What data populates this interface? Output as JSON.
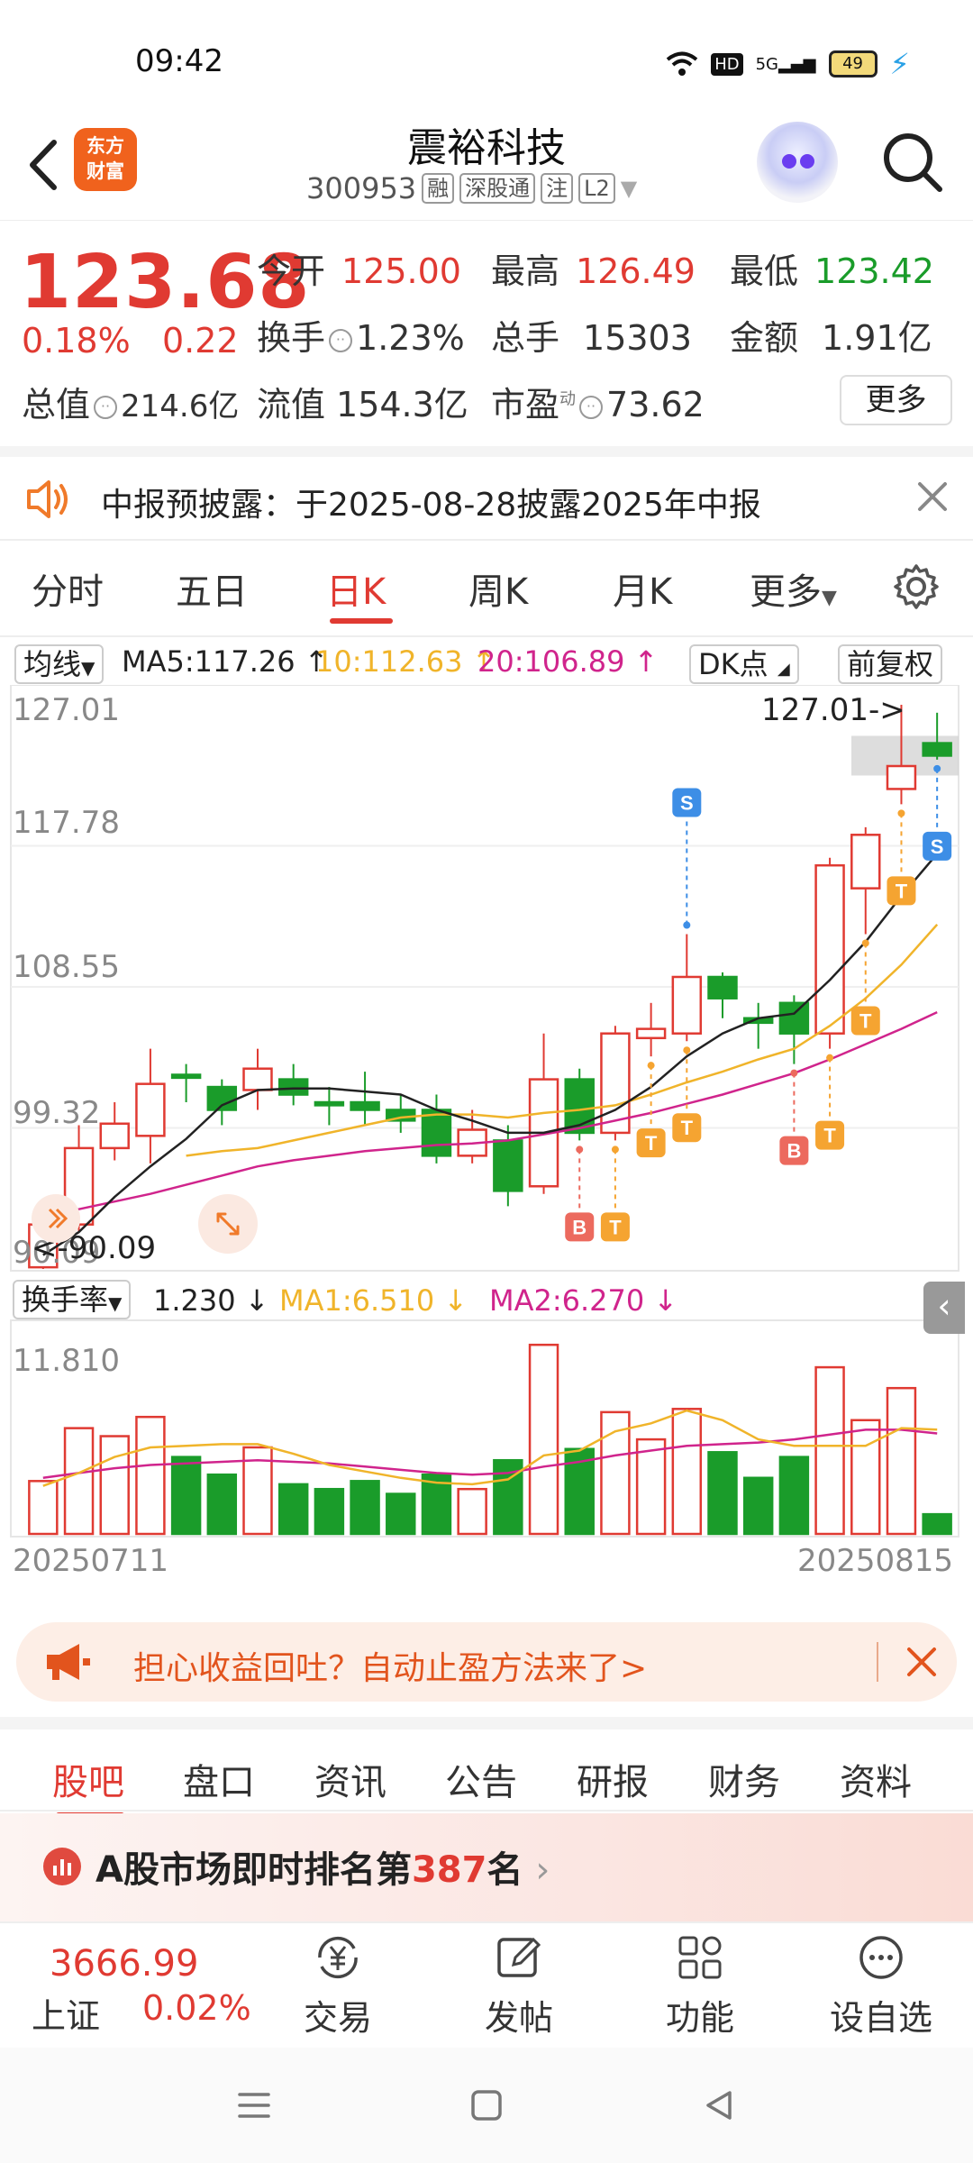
{
  "status_bar": {
    "time": "09:42",
    "hd": "HD",
    "network": "5G",
    "battery": "49"
  },
  "header": {
    "stock_name": "震裕科技",
    "stock_code": "300953",
    "tags": [
      "融",
      "深股通",
      "注",
      "L2"
    ],
    "logo_text": [
      "东方",
      "财富"
    ]
  },
  "quote": {
    "price": "123.68",
    "change_pct": "0.18%",
    "change": "0.22",
    "open_label": "今开",
    "open": "125.00",
    "high_label": "最高",
    "high": "126.49",
    "low_label": "最低",
    "low": "123.42",
    "turnover_label": "换手",
    "turnover": "1.23%",
    "volume_label": "总手",
    "volume": "15303",
    "amount_label": "金额",
    "amount": "1.91亿",
    "mktcap_label": "总值",
    "mktcap": "214.6亿",
    "float_label": "流值",
    "float": "154.3亿",
    "pe_label": "市盈",
    "pe_sup": "动",
    "pe": "73.62",
    "more": "更多"
  },
  "notice": {
    "text": "中报预披露：于2025-08-28披露2025年中报"
  },
  "chart_tabs": [
    "分时",
    "五日",
    "日K",
    "周K",
    "月K",
    "更多"
  ],
  "chart_tab_active": 2,
  "ma_legend": {
    "select": "均线",
    "ma5": "MA5:117.26",
    "ma10": "10:112.63",
    "ma20": "20:106.89",
    "dk": "DK点",
    "adjust": "前复权"
  },
  "colors": {
    "up": "#e03a32",
    "down": "#1a9c2a",
    "ma5": "#222222",
    "ma10": "#f0b42a",
    "ma20": "#d0248c",
    "brand": "#f0621d"
  },
  "chart_data": [
    {
      "type": "candlestick",
      "y_ticks": [
        "127.01",
        "117.78",
        "108.55",
        "99.32",
        "90.09"
      ],
      "ylim": [
        90.09,
        127.01
      ],
      "max_label": "127.01->",
      "min_label": "<-90.09",
      "x_start": "20250711",
      "x_end": "20250815",
      "candles": [
        {
          "o": 90.2,
          "c": 93.0,
          "h": 94.5,
          "l": 90.09
        },
        {
          "o": 93.0,
          "c": 98.0,
          "h": 99.5,
          "l": 92.5
        },
        {
          "o": 98.0,
          "c": 99.6,
          "h": 101.0,
          "l": 97.2
        },
        {
          "o": 98.8,
          "c": 102.2,
          "h": 104.5,
          "l": 97.0
        },
        {
          "o": 102.8,
          "c": 102.6,
          "h": 103.5,
          "l": 101.0
        },
        {
          "o": 102.0,
          "c": 100.5,
          "h": 102.5,
          "l": 99.5
        },
        {
          "o": 101.8,
          "c": 103.2,
          "h": 104.5,
          "l": 100.5
        },
        {
          "o": 102.5,
          "c": 101.5,
          "h": 103.5,
          "l": 100.8
        },
        {
          "o": 101.0,
          "c": 100.8,
          "h": 102.0,
          "l": 99.5
        },
        {
          "o": 101.0,
          "c": 100.5,
          "h": 103.0,
          "l": 99.5
        },
        {
          "o": 100.5,
          "c": 99.8,
          "h": 101.5,
          "l": 99.0
        },
        {
          "o": 100.5,
          "c": 97.5,
          "h": 101.5,
          "l": 97.0
        },
        {
          "o": 97.5,
          "c": 99.2,
          "h": 100.5,
          "l": 97.0
        },
        {
          "o": 98.5,
          "c": 95.2,
          "h": 99.5,
          "l": 94.2
        },
        {
          "o": 95.5,
          "c": 102.5,
          "h": 105.5,
          "l": 95.0
        },
        {
          "o": 102.5,
          "c": 99.0,
          "h": 103.2,
          "l": 98.5
        },
        {
          "o": 99.0,
          "c": 105.5,
          "h": 106.0,
          "l": 98.5
        },
        {
          "o": 105.2,
          "c": 105.8,
          "h": 107.5,
          "l": 104.0
        },
        {
          "o": 105.5,
          "c": 109.2,
          "h": 112.0,
          "l": 105.0
        },
        {
          "o": 109.2,
          "c": 107.8,
          "h": 109.5,
          "l": 106.5
        },
        {
          "o": 106.5,
          "c": 106.2,
          "h": 107.5,
          "l": 104.5
        },
        {
          "o": 107.5,
          "c": 105.5,
          "h": 108.0,
          "l": 103.5
        },
        {
          "o": 105.5,
          "c": 116.5,
          "h": 117.0,
          "l": 104.5
        },
        {
          "o": 115.0,
          "c": 118.5,
          "h": 119.0,
          "l": 112.0
        },
        {
          "o": 121.5,
          "c": 123.0,
          "h": 127.01,
          "l": 120.5
        },
        {
          "o": 124.5,
          "c": 123.68,
          "h": 126.49,
          "l": 123.42
        }
      ],
      "ma5": [
        91.0,
        92.5,
        94.8,
        96.8,
        98.6,
        100.8,
        101.8,
        101.9,
        101.9,
        101.7,
        101.5,
        100.5,
        99.8,
        99.0,
        99.0,
        99.5,
        100.5,
        102.0,
        104.0,
        105.5,
        106.5,
        106.8,
        109.0,
        111.5,
        114.5,
        117.26
      ],
      "ma10": [
        null,
        null,
        null,
        null,
        97.5,
        97.8,
        98.0,
        98.5,
        99.0,
        99.5,
        100.0,
        100.2,
        100.2,
        100.0,
        100.3,
        100.5,
        100.8,
        101.5,
        102.3,
        103.0,
        103.8,
        104.5,
        106.0,
        107.8,
        110.0,
        112.63
      ],
      "ma20": [
        93.5,
        94.0,
        94.5,
        95.0,
        95.6,
        96.2,
        96.8,
        97.2,
        97.5,
        97.8,
        98.0,
        98.2,
        98.3,
        98.5,
        98.9,
        99.3,
        99.8,
        100.3,
        100.9,
        101.5,
        102.2,
        102.9,
        103.8,
        104.8,
        105.8,
        106.89
      ],
      "markers": [
        {
          "i": 15,
          "label": "B",
          "side": "below"
        },
        {
          "i": 16,
          "label": "T",
          "side": "below"
        },
        {
          "i": 17,
          "label": "T",
          "side": "below"
        },
        {
          "i": 18,
          "label": "T",
          "side": "below"
        },
        {
          "i": 18,
          "label": "S",
          "side": "above"
        },
        {
          "i": 21,
          "label": "B",
          "side": "below"
        },
        {
          "i": 22,
          "label": "T",
          "side": "below"
        },
        {
          "i": 23,
          "label": "T",
          "side": "below"
        },
        {
          "i": 24,
          "label": "T",
          "side": "below"
        },
        {
          "i": 25,
          "label": "S",
          "side": "below"
        }
      ]
    },
    {
      "type": "bar",
      "name": "换手率",
      "current": "1.230",
      "ma1_label": "MA1:6.510",
      "ma2_label": "MA2:6.270",
      "y_max_label": "11.810",
      "ylim": [
        0,
        11.81
      ],
      "values": [
        3.3,
        6.6,
        6.1,
        7.3,
        4.8,
        3.7,
        5.4,
        3.1,
        2.8,
        3.3,
        2.5,
        3.7,
        2.8,
        4.6,
        11.8,
        5.3,
        7.6,
        5.9,
        7.8,
        5.1,
        3.5,
        4.8,
        10.4,
        7.1,
        9.1,
        1.23
      ],
      "ma1": [
        3.0,
        3.8,
        4.8,
        5.4,
        5.5,
        5.6,
        5.6,
        5.0,
        4.3,
        3.9,
        3.5,
        3.2,
        3.1,
        3.4,
        4.9,
        5.2,
        6.4,
        6.9,
        7.7,
        7.1,
        5.9,
        5.5,
        5.5,
        5.5,
        6.6,
        6.51
      ],
      "ma2": [
        3.5,
        3.8,
        4.1,
        4.3,
        4.4,
        4.5,
        4.6,
        4.5,
        4.4,
        4.2,
        4.0,
        3.8,
        3.7,
        3.8,
        4.2,
        4.5,
        4.9,
        5.2,
        5.5,
        5.6,
        5.7,
        5.9,
        6.2,
        6.5,
        6.5,
        6.27
      ]
    }
  ],
  "promo": {
    "text": "担心收益回吐？自动止盈方法来了>"
  },
  "bottom_tabs": [
    "股吧",
    "盘口",
    "资讯",
    "公告",
    "研报",
    "财务",
    "资料"
  ],
  "bottom_tab_active": 0,
  "rank": {
    "prefix": "A股市场即时排名第",
    "number": "387",
    "suffix": "名"
  },
  "bottom_bar": {
    "index_value": "3666.99",
    "index_name": "上证",
    "index_pct": "0.02%",
    "items": [
      "交易",
      "发帖",
      "功能",
      "设自选"
    ]
  }
}
